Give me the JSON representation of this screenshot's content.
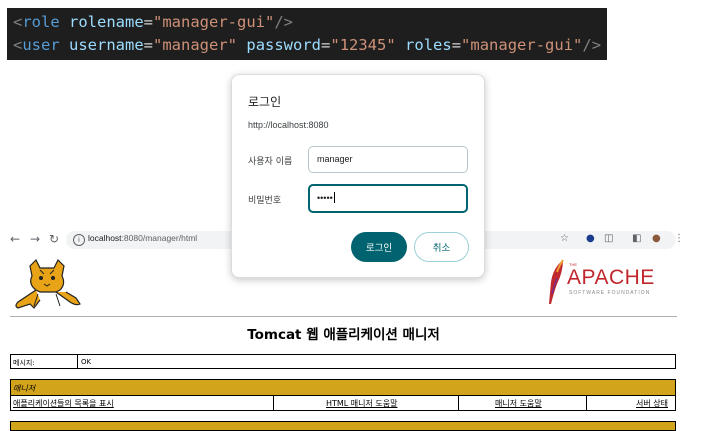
{
  "code": {
    "line1": {
      "open": "<",
      "element": "role",
      "attr1": "rolename",
      "eq": "=",
      "val1": "\"manager-gui\"",
      "close": "/>"
    },
    "line2": {
      "open": "<",
      "element": "user",
      "attr1": "username",
      "val1": "\"manager\"",
      "attr2": "password",
      "val2": "\"12345\"",
      "attr3": "roles",
      "val3": "\"manager-gui\"",
      "eq": "=",
      "close": "/>"
    }
  },
  "browser": {
    "url_host": "localhost",
    "url_rest": ":8080/manager/html",
    "info_glyph": "i"
  },
  "dialog": {
    "title": "로그인",
    "origin": "http://localhost:8080",
    "username_label": "사용자 이름",
    "username_value": "manager",
    "password_label": "비밀번호",
    "password_value": "•••••",
    "ok_label": "로그인",
    "cancel_label": "취소"
  },
  "page": {
    "title": "Tomcat 웹 애플리케이션 매니저",
    "message_label": "메시지:",
    "message_value": "OK",
    "section_title": "매니저",
    "links": [
      "애플리케이션들의 목록을 표시",
      "HTML 매니저 도움말",
      "매니저 도움말",
      "서버 상태"
    ],
    "apache_the": "THE",
    "apache_word": "APACHE",
    "apache_sub": "SOFTWARE FOUNDATION"
  },
  "colors": {
    "dialog_accent": "#00636f",
    "section_bg": "#d2a41c",
    "apache_red": "#c0282d"
  }
}
